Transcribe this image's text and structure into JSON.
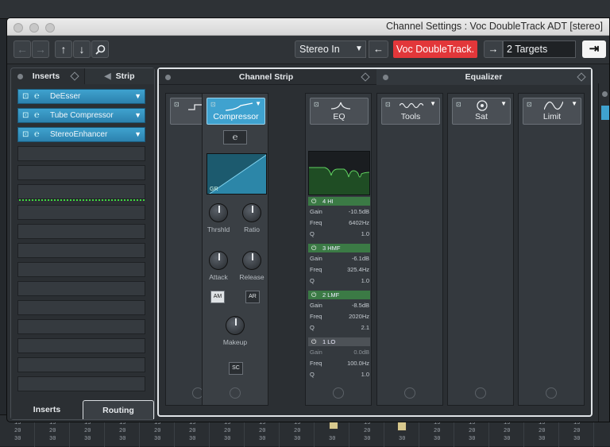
{
  "window": {
    "title": "Channel Settings : Voc DoubleTrack ADT [stereo]"
  },
  "toolbar": {
    "input_routing": "Stereo In",
    "track_name": "Voc DoubleTrack.",
    "targets": "2 Targets"
  },
  "left_panel": {
    "tab_inserts": "Inserts",
    "tab_strip": "Strip",
    "inserts": [
      {
        "label": "DeEsser"
      },
      {
        "label": "Tube Compressor"
      },
      {
        "label": "StereoEnhancer"
      }
    ],
    "bottom_tab_inserts": "Inserts",
    "bottom_tab_routing": "Routing"
  },
  "channel_strip": {
    "header": "Channel Strip",
    "gate_label": "Ga",
    "compressor": {
      "label": "Compressor",
      "graph_label": "GR",
      "knobs": {
        "threshold": "Thrshld",
        "ratio": "Ratio",
        "attack": "Attack",
        "release": "Release",
        "makeup": "Makeup"
      },
      "buttons": {
        "am": "AM",
        "ar": "AR",
        "sc": "SC"
      }
    },
    "modules": {
      "eq": "EQ",
      "tools": "Tools",
      "sat": "Sat",
      "limit": "Limit"
    }
  },
  "equalizer": {
    "header": "Equalizer",
    "bands": [
      {
        "name": "4 HI",
        "gain": "-10.5dB",
        "freq": "6402Hz",
        "q": "1.0",
        "on": true
      },
      {
        "name": "3 HMF",
        "gain": "-6.1dB",
        "freq": "325.4Hz",
        "q": "1.0",
        "on": true
      },
      {
        "name": "2 LMF",
        "gain": "-8.5dB",
        "freq": "2020Hz",
        "q": "2.1",
        "on": true
      },
      {
        "name": "1 LO",
        "gain": "0.0dB",
        "freq": "100.0Hz",
        "q": "1.0",
        "on": false
      }
    ],
    "row_labels": {
      "gain": "Gain",
      "freq": "Freq",
      "q": "Q"
    }
  },
  "mixer": {
    "values": [
      "15",
      "20",
      "30"
    ]
  }
}
